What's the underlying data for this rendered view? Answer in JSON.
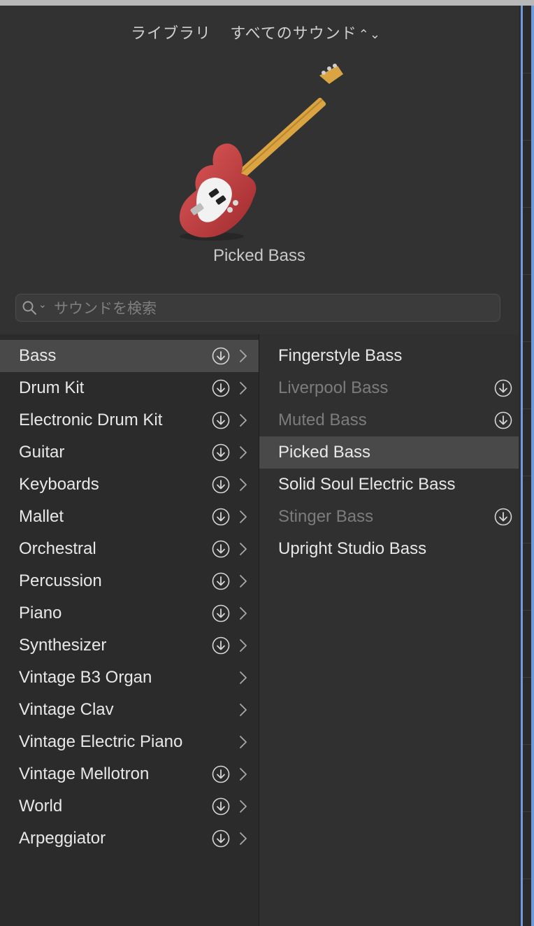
{
  "header": {
    "library_label": "ライブラリ",
    "sound_filter": "すべてのサウンド",
    "popup_icon": "up-down-chevron-icon",
    "instrument_name": "Picked Bass",
    "instrument_icon": "electric-bass-guitar-icon",
    "instrument_body_color": "#c4383b"
  },
  "search": {
    "placeholder": "サウンドを検索",
    "value": ""
  },
  "categories": [
    {
      "label": "Bass",
      "download": true,
      "selected": true
    },
    {
      "label": "Drum Kit",
      "download": true
    },
    {
      "label": "Electronic Drum Kit",
      "download": true
    },
    {
      "label": "Guitar",
      "download": true
    },
    {
      "label": "Keyboards",
      "download": true
    },
    {
      "label": "Mallet",
      "download": true
    },
    {
      "label": "Orchestral",
      "download": true
    },
    {
      "label": "Percussion",
      "download": true
    },
    {
      "label": "Piano",
      "download": true
    },
    {
      "label": "Synthesizer",
      "download": true
    },
    {
      "label": "Vintage B3 Organ",
      "download": false
    },
    {
      "label": "Vintage Clav",
      "download": false
    },
    {
      "label": "Vintage Electric Piano",
      "download": false
    },
    {
      "label": "Vintage Mellotron",
      "download": true
    },
    {
      "label": "World",
      "download": true
    },
    {
      "label": "Arpeggiator",
      "download": true
    }
  ],
  "sounds": [
    {
      "label": "Fingerstyle Bass",
      "available": true
    },
    {
      "label": "Liverpool Bass",
      "available": false
    },
    {
      "label": "Muted Bass",
      "available": false
    },
    {
      "label": "Picked Bass",
      "available": true,
      "selected": true
    },
    {
      "label": "Solid Soul Electric Bass",
      "available": true
    },
    {
      "label": "Stinger Bass",
      "available": false
    },
    {
      "label": "Upright Studio Bass",
      "available": true
    }
  ]
}
